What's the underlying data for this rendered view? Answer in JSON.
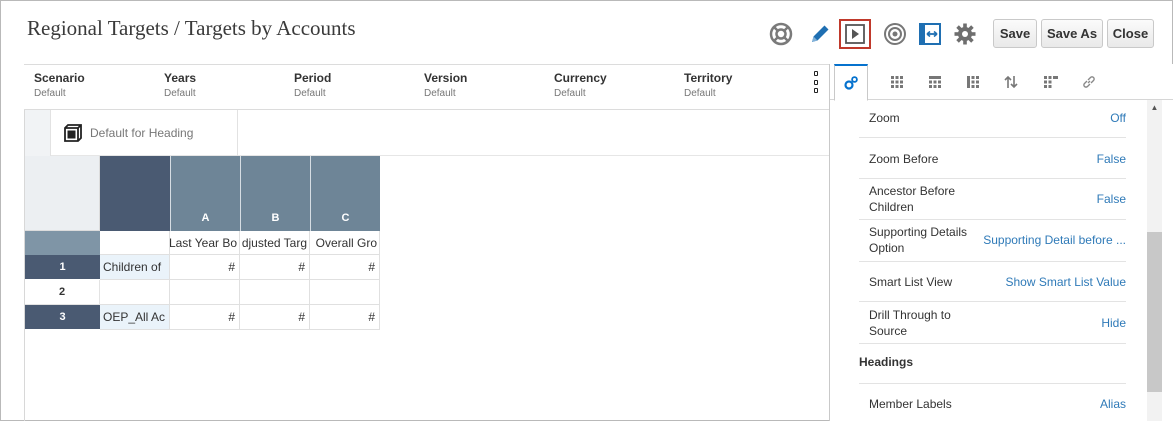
{
  "page_title": "Regional Targets / Targets by Accounts",
  "toolbar": {
    "help_icon": "lifebuoy-icon",
    "edit_icon": "pencil-icon",
    "run_icon": "play-icon",
    "target_icon": "target-icon",
    "fit_icon": "fit-width-icon",
    "settings_icon": "gear-icon",
    "save_label": "Save",
    "save_as_label": "Save As",
    "close_label": "Close"
  },
  "pov": [
    {
      "name": "Scenario",
      "value": "Default"
    },
    {
      "name": "Years",
      "value": "Default"
    },
    {
      "name": "Period",
      "value": "Default"
    },
    {
      "name": "Version",
      "value": "Default"
    },
    {
      "name": "Currency",
      "value": "Default"
    },
    {
      "name": "Territory",
      "value": "Default"
    }
  ],
  "heading": {
    "label": "Default for Heading"
  },
  "grid": {
    "columns": [
      {
        "letter": "A",
        "label": "Last Year Bo"
      },
      {
        "letter": "B",
        "label": "djusted Targ"
      },
      {
        "letter": "C",
        "label": "Overall Gro"
      }
    ],
    "rows": [
      {
        "num": "1",
        "member": "Children of",
        "values": [
          "#",
          "#",
          "#"
        ]
      },
      {
        "num": "2",
        "member": "",
        "values": [
          "",
          "",
          ""
        ]
      },
      {
        "num": "3",
        "member": "OEP_All Ac",
        "values": [
          "#",
          "#",
          "#"
        ]
      }
    ]
  },
  "panel": {
    "tabs": [
      "properties-tab",
      "grid-tab",
      "layout-tab",
      "format-tab",
      "sort-tab",
      "chart-tab",
      "link-tab"
    ],
    "properties": [
      {
        "label": "Zoom",
        "value": "Off"
      },
      {
        "label": "Zoom Before",
        "value": "False"
      },
      {
        "label": "Ancestor Before Children",
        "value": "False"
      },
      {
        "label": "Supporting Details Option",
        "value": "Supporting Detail before ..."
      },
      {
        "label": "Smart List View",
        "value": "Show Smart List Value"
      },
      {
        "label": "Drill Through to Source",
        "value": "Hide"
      }
    ],
    "section_headings": "Headings",
    "member_labels": {
      "label": "Member Labels",
      "value": "Alias"
    }
  },
  "colors": {
    "accent": "#0572ce",
    "header_dark": "#4a5a72",
    "header_col": "#6e8597",
    "link_value": "#2f7ab8",
    "run_highlight": "#c0392b"
  }
}
